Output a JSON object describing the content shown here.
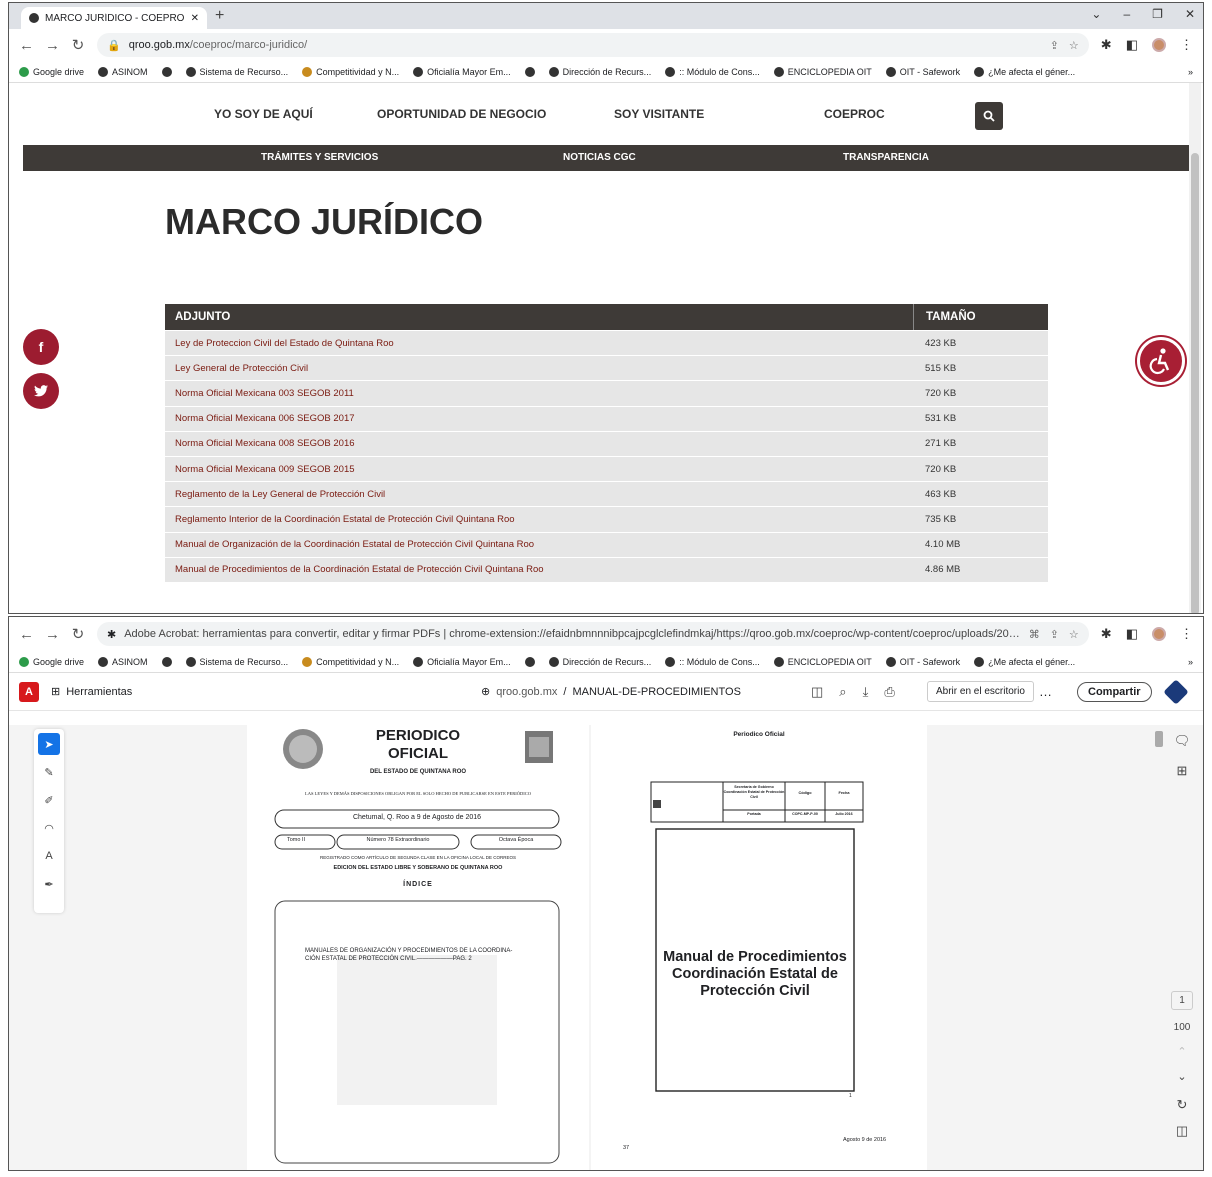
{
  "browser1": {
    "tab_title": "MARCO JURÍDICO - COEPROC - —",
    "url_domain": "qroo.gob.mx",
    "url_path": "/coeproc/marco-juridico/"
  },
  "browser2": {
    "url": "Adobe Acrobat: herramientas para convertir, editar y firmar PDFs  |  chrome-extension://efaidnbmnnnibpcajpcglclefindmkaj/https://qroo.gob.mx/coeproc/wp-content/coeproc/uploads/2023/08/M..."
  },
  "bookmarks": [
    "Google drive",
    "ASINOM",
    "",
    "Sistema de Recurso...",
    "Competitividad y N...",
    "Oficialía Mayor Em...",
    "",
    "Dirección de Recurs...",
    ":: Módulo de Cons...",
    "ENCICLOPEDIA OIT",
    "OIT - Safework",
    "¿Me afecta el géner..."
  ],
  "site": {
    "nav": [
      "YO SOY DE AQUÍ",
      "OPORTUNIDAD DE NEGOCIO",
      "SOY VISITANTE",
      "COEPROC"
    ],
    "subnav": [
      "TRÁMITES Y SERVICIOS",
      "NOTICIAS CGC",
      "TRANSPARENCIA"
    ],
    "title": "MARCO JURÍDICO",
    "table_headers": [
      "ADJUNTO",
      "TAMAÑO"
    ],
    "rows": [
      [
        "Ley de Proteccion Civil del Estado de Quintana Roo",
        "423 KB"
      ],
      [
        "Ley General de Protección Civil",
        "515 KB"
      ],
      [
        "Norma Oficial Mexicana 003 SEGOB 2011",
        "720 KB"
      ],
      [
        "Norma Oficial Mexicana 006 SEGOB 2017",
        "531 KB"
      ],
      [
        "Norma Oficial Mexicana 008 SEGOB 2016",
        "271 KB"
      ],
      [
        "Norma Oficial Mexicana 009 SEGOB 2015",
        "720 KB"
      ],
      [
        "Reglamento de la Ley General de Protección Civil",
        "463 KB"
      ],
      [
        "Reglamento Interior de la Coordinación Estatal de Protección Civil Quintana Roo",
        "735 KB"
      ],
      [
        "Manual de Organización de la Coordinación Estatal de Protección Civil Quintana Roo",
        "4.10 MB"
      ],
      [
        "Manual de Procedimientos de la Coordinación Estatal de Protección Civil Quintana Roo",
        "4.86 MB"
      ]
    ]
  },
  "acrobat": {
    "tools_label": "Herramientas",
    "doc_domain": "qroo.gob.mx",
    "doc_sep": "/",
    "doc_name": "MANUAL-DE-PROCEDIMIENTOS",
    "open_desktop": "Abrir en el escritorio",
    "share": "Compartir",
    "page_num": "1",
    "zoom": "100"
  },
  "pdf_left": {
    "title1": "PERIODICO",
    "title2": "OFICIAL",
    "subtitle": "DEL ESTADO DE QUINTANA ROO",
    "law_line": "LAS LEYES Y DEMÁS DISPOSICIONES OBLIGAN POR EL SOLO HECHO DE PUBLICARSE EN ESTE PERIÓDICO",
    "date_line": "Chetumal, Q. Roo a 9 de Agosto de 2016",
    "tomo": "Tomo II",
    "numero": "Número 78 Extraordinario",
    "epoca": "Octava Época",
    "registro": "REGISTRADO COMO ARTÍCULO DE SEGUNDA CLASE EN LA OFICINA LOCAL DE CORREOS",
    "edicion": "EDICION DEL ESTADO LIBRE Y SOBERANO DE QUINTANA ROO",
    "indice": "ÍNDICE",
    "content1": "MANUALES DE ORGANIZACIÓN Y PROCEDIMIENTOS DE LA COORDINA-",
    "content2": "CIÓN ESTATAL DE PROTECCIÓN CIVIL.——————PAG. 2",
    "page_no": "37"
  },
  "pdf_right": {
    "header": "Periodico Oficial",
    "col1a": "Secretaría de Gobierno",
    "col1b": "Coordinación Estatal de Protección Civil",
    "col1c": "Portada",
    "col2": "Código",
    "col2b": "COPC-MP-P-00",
    "col3": "Fecha",
    "col3b": "Julio 2016",
    "main1": "Manual de Procedimientos",
    "main2": "Coordinación Estatal de",
    "main3": "Protección Civil",
    "footer_date": "Agosto 9  de 2016",
    "pg": "1"
  },
  "colors": {
    "brand_dark": "#3e3a37",
    "social": "#9c1c30",
    "link": "#7a1a10",
    "acrobat_red": "#d7191c"
  }
}
